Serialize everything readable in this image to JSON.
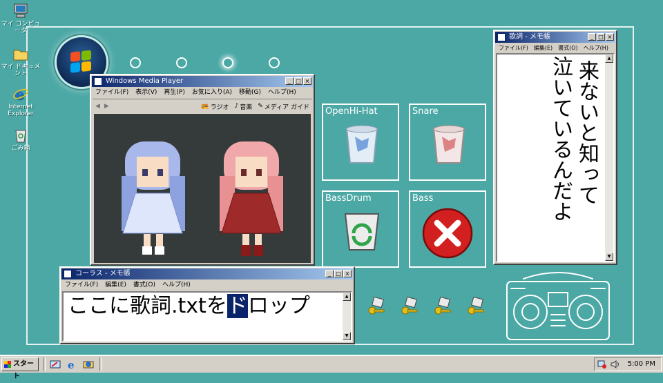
{
  "desktop": {
    "icons": [
      {
        "label": "マイ コンピュータ"
      },
      {
        "label": "マイ ドキュメント"
      },
      {
        "label": "Internet Explorer"
      },
      {
        "label": "ごみ箱"
      }
    ]
  },
  "wmp": {
    "title": "Windows Media Player",
    "menu": [
      "ファイル(F)",
      "表示(V)",
      "再生(P)",
      "お気に入り(A)",
      "移動(G)",
      "ヘルプ(H)"
    ],
    "nav": [
      "ラジオ",
      "音楽",
      "メディア ガイド"
    ]
  },
  "chorus": {
    "title": "コーラス - メモ帳",
    "menu": [
      "ファイル(F)",
      "編集(E)",
      "書式(O)",
      "ヘルプ(H)"
    ],
    "text_before": "ここに歌詞.txtを",
    "text_selected": "ド",
    "text_after": "ロップ"
  },
  "lyrics": {
    "title": "歌詞 - メモ帳",
    "menu": [
      "ファイル(F)",
      "編集(E)",
      "書式(O)",
      "ヘルプ(H)"
    ],
    "line1": "来ないと知って",
    "line2": "泣いているんだよ"
  },
  "bins": [
    {
      "label": "OpenHi-Hat"
    },
    {
      "label": "Snare"
    },
    {
      "label": "BassDrum"
    },
    {
      "label": "Bass"
    }
  ],
  "taskbar": {
    "start_label": "スタート",
    "clock": "5:00 PM"
  },
  "colors": {
    "desktop": "#4ba8a5",
    "title_active": "#0a246a",
    "selection": "#0a246a",
    "error_red": "#d21f1f"
  }
}
